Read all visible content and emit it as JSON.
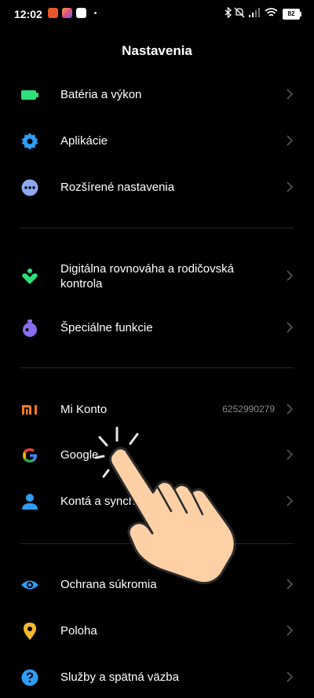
{
  "status_bar": {
    "time": "12:02",
    "battery": "82",
    "notification_colors": [
      "#e8572a",
      "#e04e86",
      "#ffffff"
    ]
  },
  "header": {
    "title": "Nastavenia"
  },
  "sections": [
    {
      "items": [
        {
          "label": "Batéria a výkon",
          "icon": "battery-icon",
          "color": "#2ee07a"
        },
        {
          "label": "Aplikácie",
          "icon": "gear-icon",
          "color": "#2f9df4"
        },
        {
          "label": "Rozšírené nastavenia",
          "icon": "more-dots-icon",
          "color": "#8ea8f0"
        }
      ]
    },
    {
      "items": [
        {
          "label": "Digitálna rovnováha a rodičovská kontrola",
          "icon": "digital-wellbeing-icon",
          "color": "#2ee07a"
        },
        {
          "label": "Špeciálne funkcie",
          "icon": "special-features-icon",
          "color": "#8a6cf0"
        }
      ]
    },
    {
      "items": [
        {
          "label": "Mi Konto",
          "icon": "mi-logo-icon",
          "color": "#f27a1a",
          "value": "6252990279"
        },
        {
          "label": "Google",
          "icon": "google-icon",
          "color": "#4285f4"
        },
        {
          "label": "Kontá a synchr",
          "icon": "account-icon",
          "color": "#2f9df4"
        }
      ]
    },
    {
      "items": [
        {
          "label": "Ochrana súkromia",
          "icon": "eye-icon",
          "color": "#2f9df4"
        },
        {
          "label": "Poloha",
          "icon": "location-pin-icon",
          "color": "#f5b82e"
        },
        {
          "label": "Služby a spätná väzba",
          "icon": "help-icon",
          "color": "#2f9df4"
        }
      ]
    }
  ]
}
